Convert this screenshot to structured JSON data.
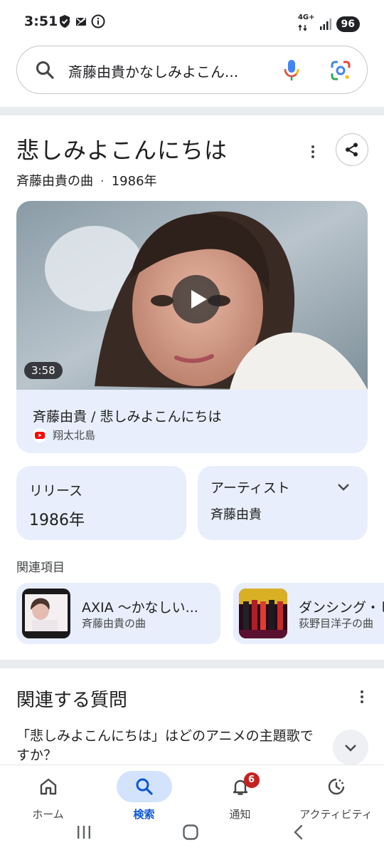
{
  "status_bar": {
    "time": "3:51",
    "network": "4G+",
    "battery": "96"
  },
  "search": {
    "query": "斎藤由貴かなしみよこん..."
  },
  "knowledge_panel": {
    "title": "悲しみよこんにちは",
    "subtitle_song": "斉藤由貴の曲",
    "subtitle_year": "1986年"
  },
  "video": {
    "duration": "3:58",
    "title": "斉藤由貴 / 悲しみよこんにちは",
    "channel": "翔太北島"
  },
  "release": {
    "label": "リリース",
    "value": "1986年"
  },
  "artist": {
    "label": "アーティスト",
    "value": "斉藤由貴"
  },
  "related": {
    "label": "関連項目",
    "items": [
      {
        "title": "AXIA ～かなしい...",
        "subtitle": "斉藤由貴の曲"
      },
      {
        "title": "ダンシング・ヒ",
        "subtitle": "荻野目洋子の曲"
      }
    ]
  },
  "paa": {
    "title": "関連する質問",
    "question": "「悲しみよこんにちは」はどのアニメの主題歌ですか？"
  },
  "bottom_nav": {
    "items": [
      {
        "label": "ホーム"
      },
      {
        "label": "検索"
      },
      {
        "label": "通知",
        "badge": "6"
      },
      {
        "label": "アクティビティ"
      }
    ]
  },
  "colors": {
    "accent": "#0b57d0",
    "card": "#e8eefc",
    "badge": "#c5221f"
  }
}
